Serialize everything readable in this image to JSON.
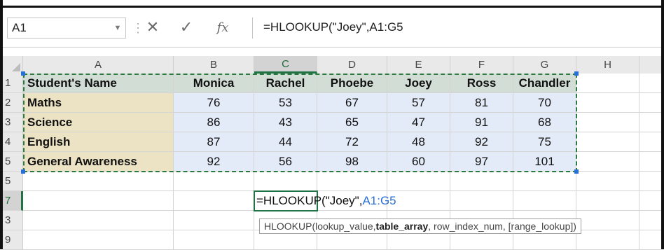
{
  "name_box": {
    "value": "A1"
  },
  "formula_bar": {
    "cancel_glyph": "✕",
    "enter_glyph": "✓",
    "fx_label": "fx",
    "formula": "=HLOOKUP(\"Joey\",A1:G5"
  },
  "columns": [
    "A",
    "B",
    "C",
    "D",
    "E",
    "F",
    "G",
    "H"
  ],
  "rows": [
    "1",
    "2",
    "3",
    "4",
    "5",
    "5",
    "7",
    "3",
    "9"
  ],
  "table": {
    "header": [
      "Student's Name",
      "Monica",
      "Rachel",
      "Phoebe",
      "Joey",
      "Ross",
      "Chandler"
    ],
    "data": [
      [
        "Maths",
        "76",
        "53",
        "67",
        "57",
        "81",
        "70"
      ],
      [
        "Science",
        "86",
        "43",
        "65",
        "47",
        "91",
        "68"
      ],
      [
        "English",
        "87",
        "44",
        "72",
        "48",
        "92",
        "75"
      ],
      [
        "General Awareness",
        "92",
        "56",
        "98",
        "60",
        "97",
        "101"
      ]
    ]
  },
  "in_cell_edit": {
    "prefix": "=HLOOKUP(\"Joey\",",
    "range_ref": "A1:G5"
  },
  "tooltip": {
    "fn": "HLOOKUP(",
    "arg1": "lookup_value, ",
    "arg2": "table_array",
    "arg3": ", row_index_num, [range_lookup])"
  },
  "colors": {
    "header_fill": "#d1ddd5",
    "name_fill": "#ece3c4",
    "number_fill": "#e4ebf8",
    "selection_green": "#217346",
    "reference_blue": "#2a6fd6"
  }
}
